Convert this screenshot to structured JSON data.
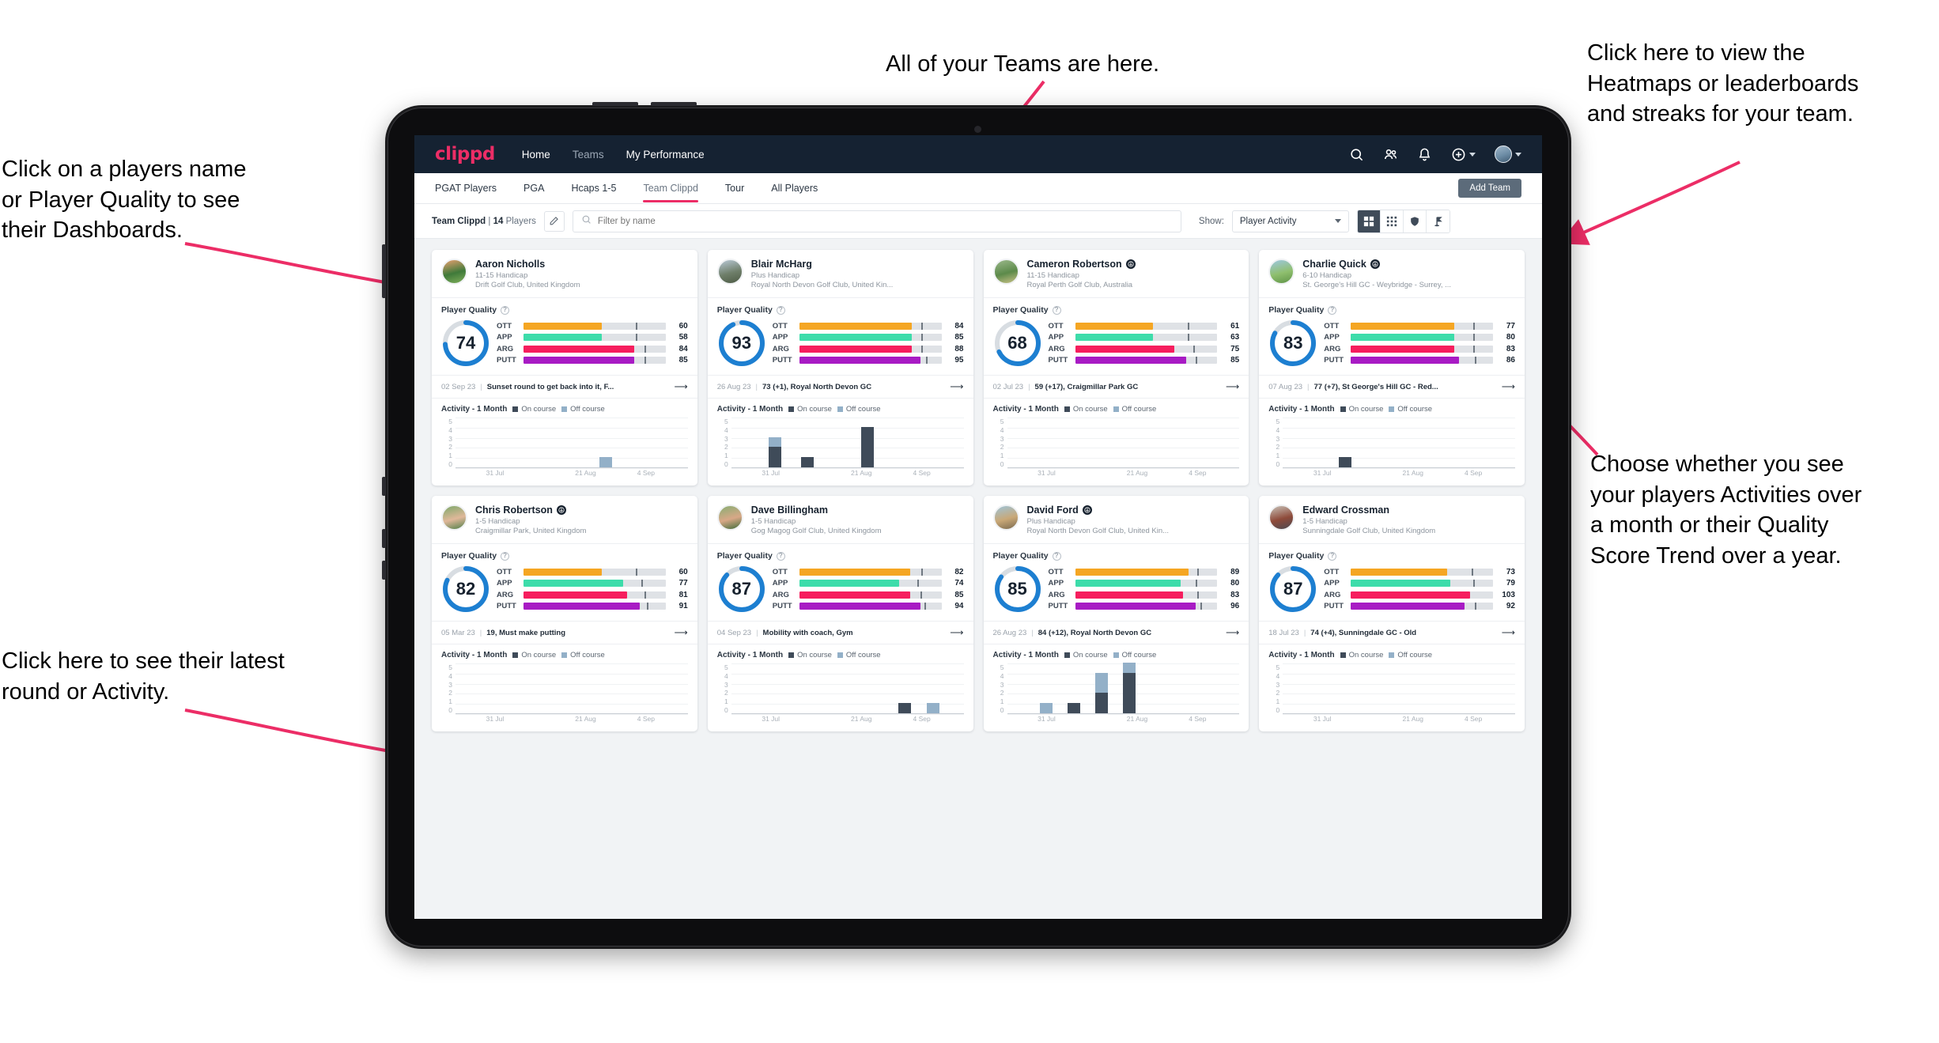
{
  "annotations": [
    {
      "id": "teams",
      "text": "All of your Teams are here."
    },
    {
      "id": "heatmaps",
      "text": "Click here to view the\nHeatmaps or leaderboards\nand streaks for your team."
    },
    {
      "id": "players",
      "text": "Click on a players name\nor Player Quality to see\ntheir Dashboards."
    },
    {
      "id": "show-toggle",
      "text": "Choose whether you see\nyour players Activities over\na month or their Quality\nScore Trend over a year."
    },
    {
      "id": "latest-round",
      "text": "Click here to see their latest\nround or Activity."
    }
  ],
  "header": {
    "logo": "clippd",
    "nav": [
      {
        "label": "Home",
        "active": true
      },
      {
        "label": "Teams",
        "active": false
      },
      {
        "label": "My Performance",
        "active": true
      }
    ],
    "icons": [
      "search-icon",
      "people-icon",
      "bell-icon",
      "plus-circle-icon",
      "avatar"
    ]
  },
  "subnav": {
    "tabs": [
      {
        "label": "PGAT Players",
        "active": false
      },
      {
        "label": "PGA",
        "active": false
      },
      {
        "label": "Hcaps 1-5",
        "active": false
      },
      {
        "label": "Team Clippd",
        "active": true
      },
      {
        "label": "Tour",
        "active": false
      },
      {
        "label": "All Players",
        "active": false
      }
    ],
    "add_team_label": "Add Team"
  },
  "filterbar": {
    "team_label": "Team Clippd",
    "separator": "|",
    "player_count": "14",
    "players_word": "Players",
    "edit_icon": "pencil-icon",
    "search_placeholder": "Filter by name",
    "search_value": "",
    "show_label": "Show:",
    "show_selected": "Player Activity",
    "show_options": [
      "Player Activity",
      "Quality Score Trend"
    ],
    "view_buttons": [
      {
        "name": "grid-view-icon",
        "active": true
      },
      {
        "name": "dots-grid-view-icon",
        "active": false
      },
      {
        "name": "shield-view-icon",
        "active": false
      },
      {
        "name": "flag-view-icon",
        "active": false
      }
    ]
  },
  "quality_section": {
    "title": "Player Quality",
    "help_icon": "help-circle-icon",
    "metrics": [
      "OTT",
      "APP",
      "ARG",
      "PUTT"
    ],
    "colors": {
      "OTT": "#f5a623",
      "APP": "#3ddcaa",
      "ARG": "#f61e5e",
      "PUTT": "#a81bc4"
    }
  },
  "activity_section": {
    "title": "Activity - 1 Month",
    "legend": [
      {
        "label": "On course",
        "color": "#3f4b59"
      },
      {
        "label": "Off course",
        "color": "#93b0c8"
      }
    ],
    "y_ticks": [
      "5",
      "4",
      "3",
      "2",
      "1",
      "0"
    ],
    "x_ticks": [
      "31 Jul",
      "21 Aug",
      "4 Sep"
    ]
  },
  "colors": {
    "brand_pink": "#ec2d66",
    "header_navy": "#152232",
    "donut_blue": "#1d7fd1",
    "donut_track": "#d8dde2",
    "annotation_arrow": "#ec2d66"
  },
  "players": [
    {
      "name": "Aaron Nicholls",
      "verified": false,
      "handicap": "11-15 Handicap",
      "club": "Drift Golf Club, United Kingdom",
      "avatar_colors": [
        "#e8a070",
        "#3f7a3a",
        "#7fae5a"
      ],
      "quality_score": 74,
      "metrics": [
        {
          "key": "OTT",
          "value": 60,
          "fill_pct": 55,
          "tick_pct": 79
        },
        {
          "key": "APP",
          "value": 58,
          "fill_pct": 55,
          "tick_pct": 79
        },
        {
          "key": "ARG",
          "value": 84,
          "fill_pct": 78,
          "tick_pct": 85
        },
        {
          "key": "PUTT",
          "value": 85,
          "fill_pct": 78,
          "tick_pct": 85
        }
      ],
      "round": {
        "date": "02 Sep 23",
        "text": "Sunset round to get back into it, F..."
      },
      "activity": [
        {
          "x_pct": 20,
          "on": 0,
          "off": 0
        },
        {
          "x_pct": 62,
          "on": 0,
          "off": 1
        }
      ]
    },
    {
      "name": "Blair McHarg",
      "verified": false,
      "handicap": "Plus Handicap",
      "club": "Royal North Devon Golf Club, United Kin...",
      "avatar_colors": [
        "#b9c9d6",
        "#6f7f6a",
        "#4d5b45"
      ],
      "quality_score": 93,
      "metrics": [
        {
          "key": "OTT",
          "value": 84,
          "fill_pct": 79,
          "tick_pct": 86
        },
        {
          "key": "APP",
          "value": 85,
          "fill_pct": 79,
          "tick_pct": 86
        },
        {
          "key": "ARG",
          "value": 88,
          "fill_pct": 79,
          "tick_pct": 86
        },
        {
          "key": "PUTT",
          "value": 95,
          "fill_pct": 85,
          "tick_pct": 89
        }
      ],
      "round": {
        "date": "26 Aug 23",
        "text": "73 (+1), Royal North Devon GC"
      },
      "activity": [
        {
          "x_pct": 16,
          "on": 2,
          "off": 1
        },
        {
          "x_pct": 30,
          "on": 1,
          "off": 0
        },
        {
          "x_pct": 56,
          "on": 4,
          "off": 0
        }
      ]
    },
    {
      "name": "Cameron Robertson",
      "verified": true,
      "handicap": "11-15 Handicap",
      "club": "Royal Perth Golf Club, Australia",
      "avatar_colors": [
        "#9cb98c",
        "#5c8a4a",
        "#c9c287"
      ],
      "quality_score": 68,
      "metrics": [
        {
          "key": "OTT",
          "value": 61,
          "fill_pct": 55,
          "tick_pct": 79
        },
        {
          "key": "APP",
          "value": 63,
          "fill_pct": 55,
          "tick_pct": 79
        },
        {
          "key": "ARG",
          "value": 75,
          "fill_pct": 70,
          "tick_pct": 83
        },
        {
          "key": "PUTT",
          "value": 85,
          "fill_pct": 78,
          "tick_pct": 85
        }
      ],
      "round": {
        "date": "02 Jul 23",
        "text": "59 (+17), Craigmillar Park GC"
      },
      "activity": []
    },
    {
      "name": "Charlie Quick",
      "verified": true,
      "handicap": "6-10 Handicap",
      "club": "St. George's Hill GC - Weybridge - Surrey, ...",
      "avatar_colors": [
        "#9ec8e2",
        "#8fbf6e",
        "#5f9447"
      ],
      "quality_score": 83,
      "metrics": [
        {
          "key": "OTT",
          "value": 77,
          "fill_pct": 73,
          "tick_pct": 86
        },
        {
          "key": "APP",
          "value": 80,
          "fill_pct": 73,
          "tick_pct": 86
        },
        {
          "key": "ARG",
          "value": 83,
          "fill_pct": 73,
          "tick_pct": 86
        },
        {
          "key": "PUTT",
          "value": 86,
          "fill_pct": 76,
          "tick_pct": 87
        }
      ],
      "round": {
        "date": "07 Aug 23",
        "text": "77 (+7), St George's Hill GC - Red..."
      },
      "activity": [
        {
          "x_pct": 24,
          "on": 1,
          "off": 0
        }
      ]
    },
    {
      "name": "Chris Robertson",
      "verified": true,
      "handicap": "1-5 Handicap",
      "club": "Craigmillar Park, United Kingdom",
      "avatar_colors": [
        "#7da86a",
        "#e0b89a",
        "#4f7f48"
      ],
      "quality_score": 82,
      "metrics": [
        {
          "key": "OTT",
          "value": 60,
          "fill_pct": 55,
          "tick_pct": 79
        },
        {
          "key": "APP",
          "value": 77,
          "fill_pct": 70,
          "tick_pct": 83
        },
        {
          "key": "ARG",
          "value": 81,
          "fill_pct": 73,
          "tick_pct": 85
        },
        {
          "key": "PUTT",
          "value": 91,
          "fill_pct": 82,
          "tick_pct": 87
        }
      ],
      "round": {
        "date": "05 Mar 23",
        "text": "19, Must make putting"
      },
      "activity": []
    },
    {
      "name": "Dave Billingham",
      "verified": false,
      "handicap": "1-5 Handicap",
      "club": "Gog Magog Golf Club, United Kingdom",
      "avatar_colors": [
        "#89ad72",
        "#d8a887",
        "#3f6b3a"
      ],
      "quality_score": 87,
      "metrics": [
        {
          "key": "OTT",
          "value": 82,
          "fill_pct": 78,
          "tick_pct": 86
        },
        {
          "key": "APP",
          "value": 74,
          "fill_pct": 70,
          "tick_pct": 83
        },
        {
          "key": "ARG",
          "value": 85,
          "fill_pct": 78,
          "tick_pct": 85
        },
        {
          "key": "PUTT",
          "value": 94,
          "fill_pct": 85,
          "tick_pct": 88
        }
      ],
      "round": {
        "date": "04 Sep 23",
        "text": "Mobility with coach, Gym"
      },
      "activity": [
        {
          "x_pct": 72,
          "on": 1,
          "off": 0
        },
        {
          "x_pct": 84,
          "on": 0,
          "off": 1
        }
      ]
    },
    {
      "name": "David Ford",
      "verified": true,
      "handicap": "Plus Handicap",
      "club": "Royal North Devon Golf Club, United Kin...",
      "avatar_colors": [
        "#9ec4d8",
        "#c9a877",
        "#7a6a4f"
      ],
      "quality_score": 85,
      "metrics": [
        {
          "key": "OTT",
          "value": 89,
          "fill_pct": 80,
          "tick_pct": 86
        },
        {
          "key": "APP",
          "value": 80,
          "fill_pct": 74,
          "tick_pct": 85
        },
        {
          "key": "ARG",
          "value": 83,
          "fill_pct": 76,
          "tick_pct": 86
        },
        {
          "key": "PUTT",
          "value": 96,
          "fill_pct": 85,
          "tick_pct": 88
        }
      ],
      "round": {
        "date": "26 Aug 23",
        "text": "84 (+12), Royal North Devon GC"
      },
      "activity": [
        {
          "x_pct": 14,
          "on": 0,
          "off": 1
        },
        {
          "x_pct": 26,
          "on": 1,
          "off": 0
        },
        {
          "x_pct": 38,
          "on": 2,
          "off": 2
        },
        {
          "x_pct": 50,
          "on": 4,
          "off": 1
        }
      ]
    },
    {
      "name": "Edward Crossman",
      "verified": false,
      "handicap": "1-5 Handicap",
      "club": "Sunningdale Golf Club, United Kingdom",
      "avatar_colors": [
        "#c8c2b8",
        "#8e4a3a",
        "#4a4a52"
      ],
      "quality_score": 87,
      "metrics": [
        {
          "key": "OTT",
          "value": 73,
          "fill_pct": 68,
          "tick_pct": 85
        },
        {
          "key": "APP",
          "value": 79,
          "fill_pct": 70,
          "tick_pct": 86
        },
        {
          "key": "ARG",
          "value": 103,
          "fill_pct": 84,
          "tick_pct": 0
        },
        {
          "key": "PUTT",
          "value": 92,
          "fill_pct": 80,
          "tick_pct": 87
        }
      ],
      "round": {
        "date": "18 Jul 23",
        "text": "74 (+4), Sunningdale GC - Old"
      },
      "activity": []
    }
  ]
}
